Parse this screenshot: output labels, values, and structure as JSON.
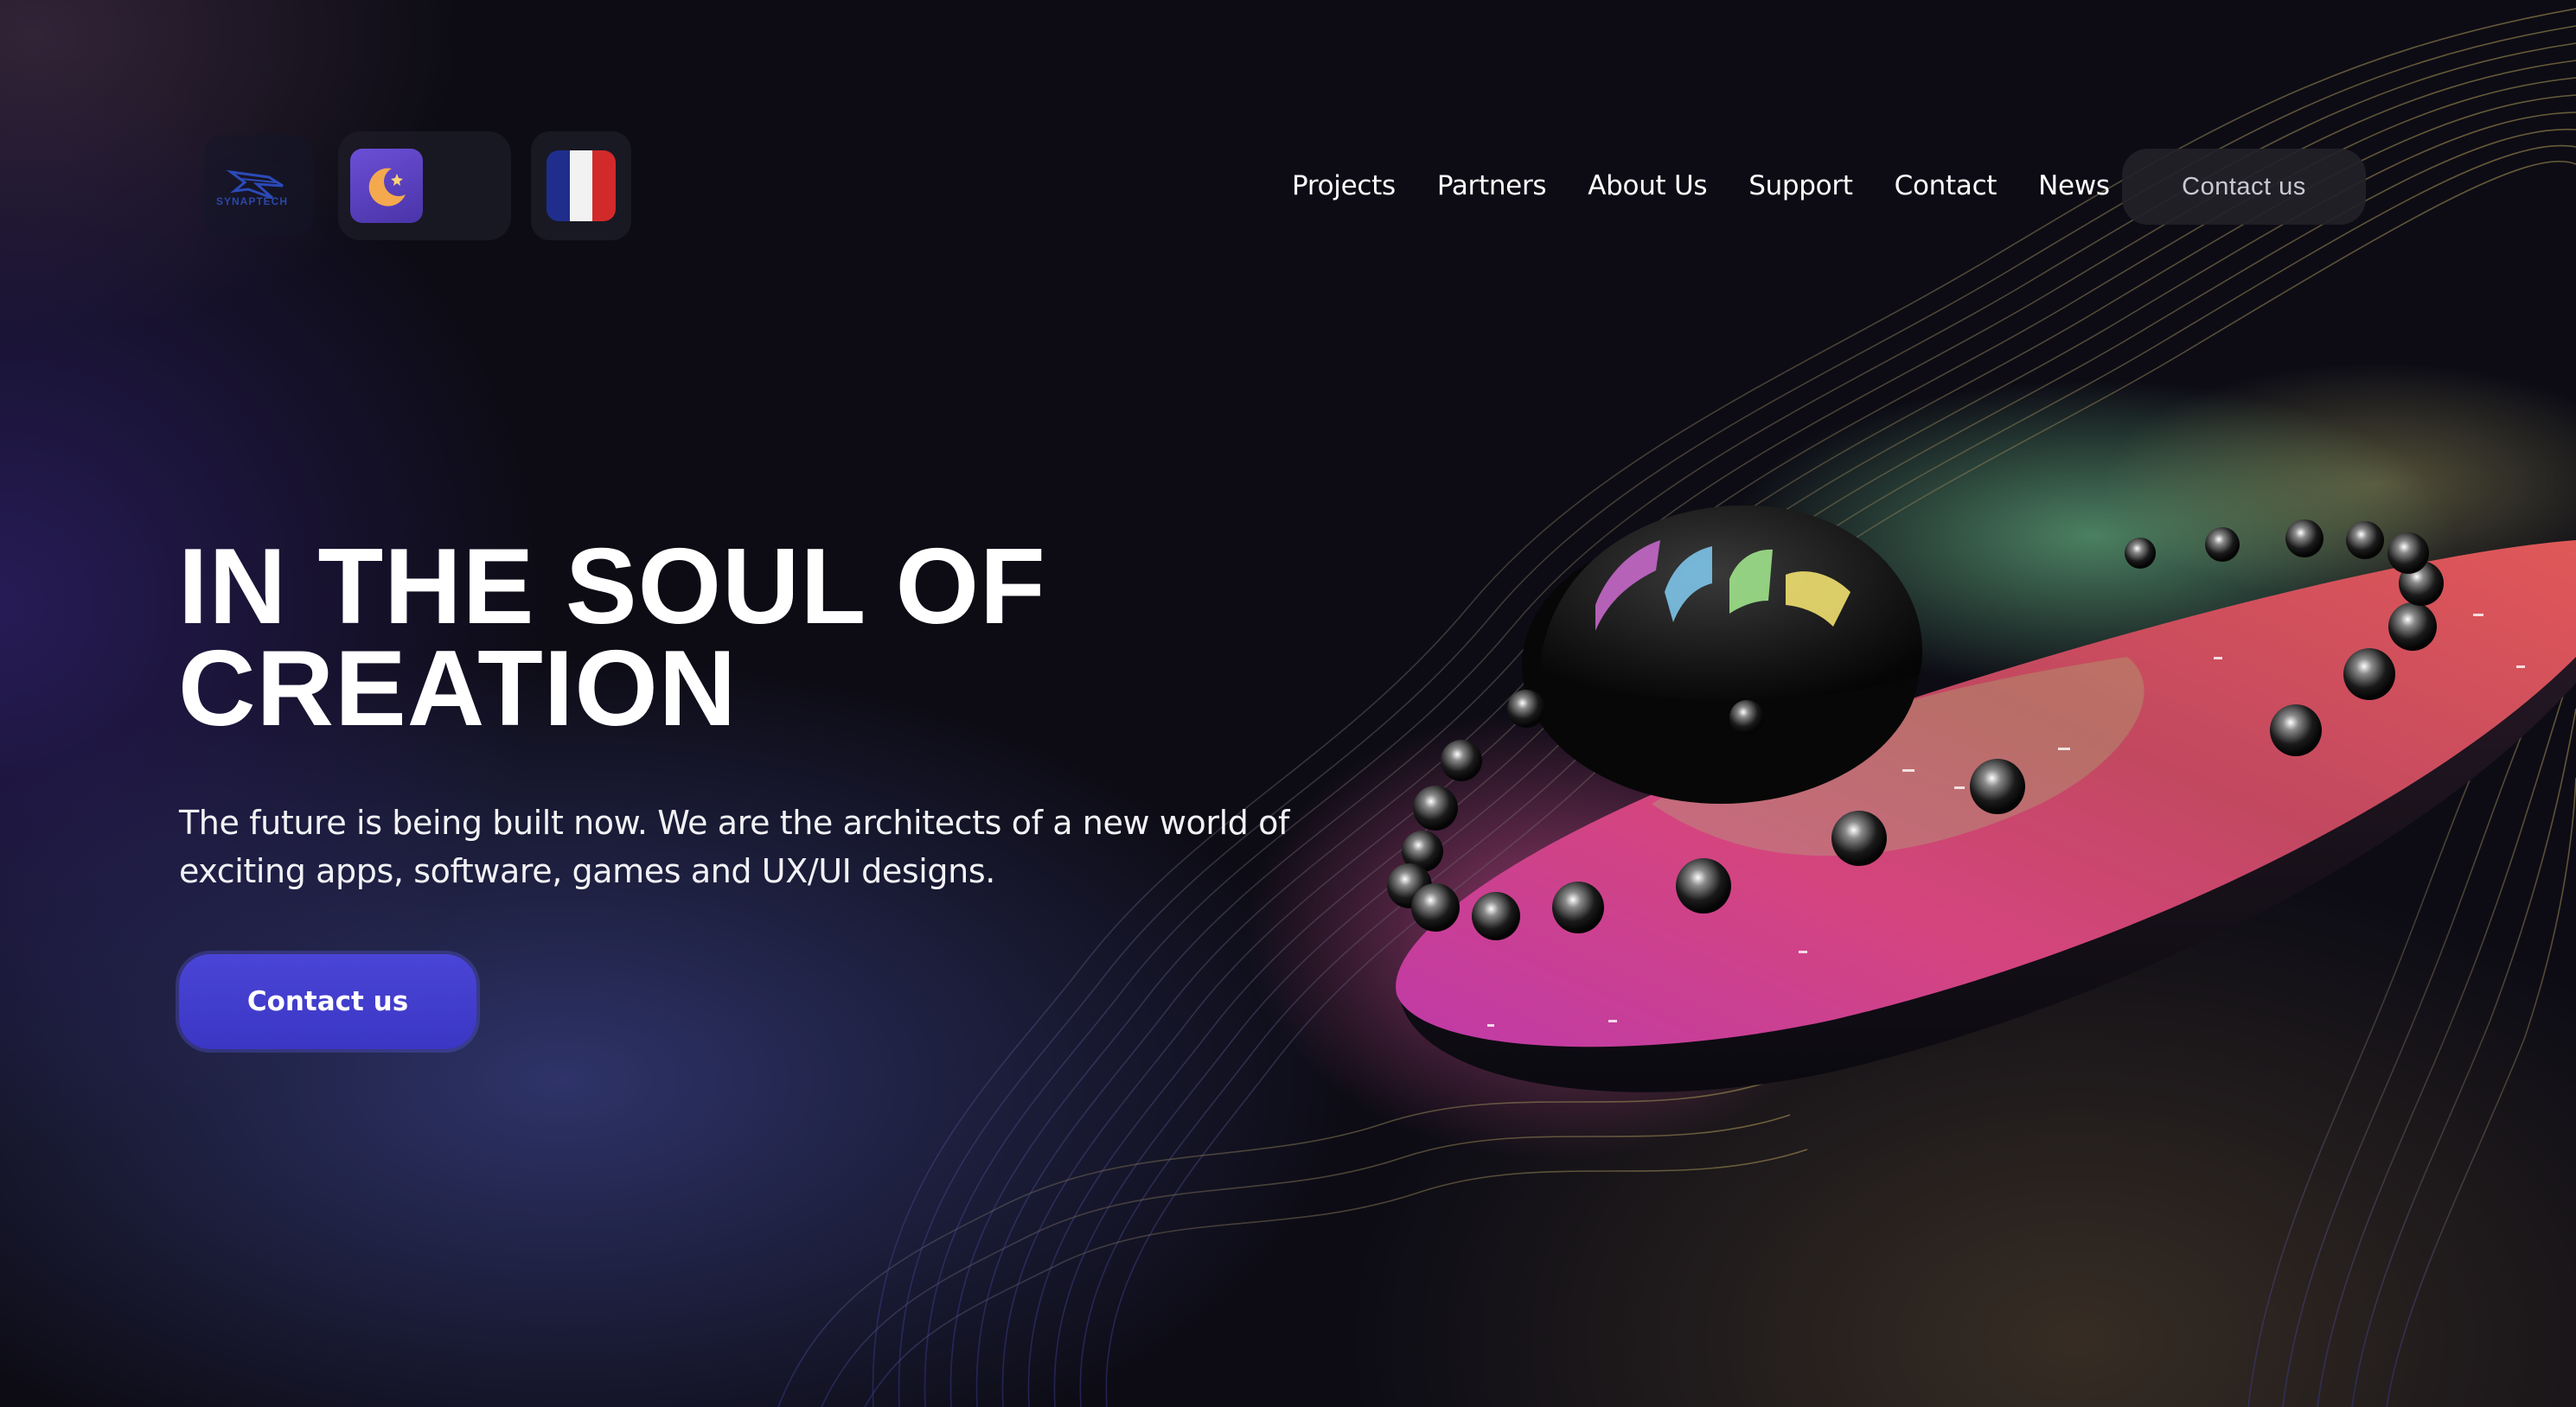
{
  "header": {
    "logo_text": "SYNAPTECH",
    "nav_items": [
      {
        "label": "Projects"
      },
      {
        "label": "Partners"
      },
      {
        "label": "About Us"
      },
      {
        "label": "Support"
      },
      {
        "label": "Contact"
      },
      {
        "label": "News"
      }
    ],
    "cta_label": "Contact us",
    "theme_icon": "moon-icon",
    "language_icon": "french-flag-icon"
  },
  "hero": {
    "title_line1": "IN THE SOUL OF",
    "title_line2": "CREATION",
    "subtitle_line1": "The future is being built now. We are the architects of a new world of",
    "subtitle_line2": "exciting apps, software, games and UX/UI designs.",
    "cta_label": "Contact us"
  },
  "colors": {
    "background": "#0d0c15",
    "accent": "#4a45d6",
    "nav_button_bg": "#222228",
    "flag_blue": "#1f2e8c",
    "flag_white": "#f2f2f2",
    "flag_red": "#d22a2a"
  }
}
